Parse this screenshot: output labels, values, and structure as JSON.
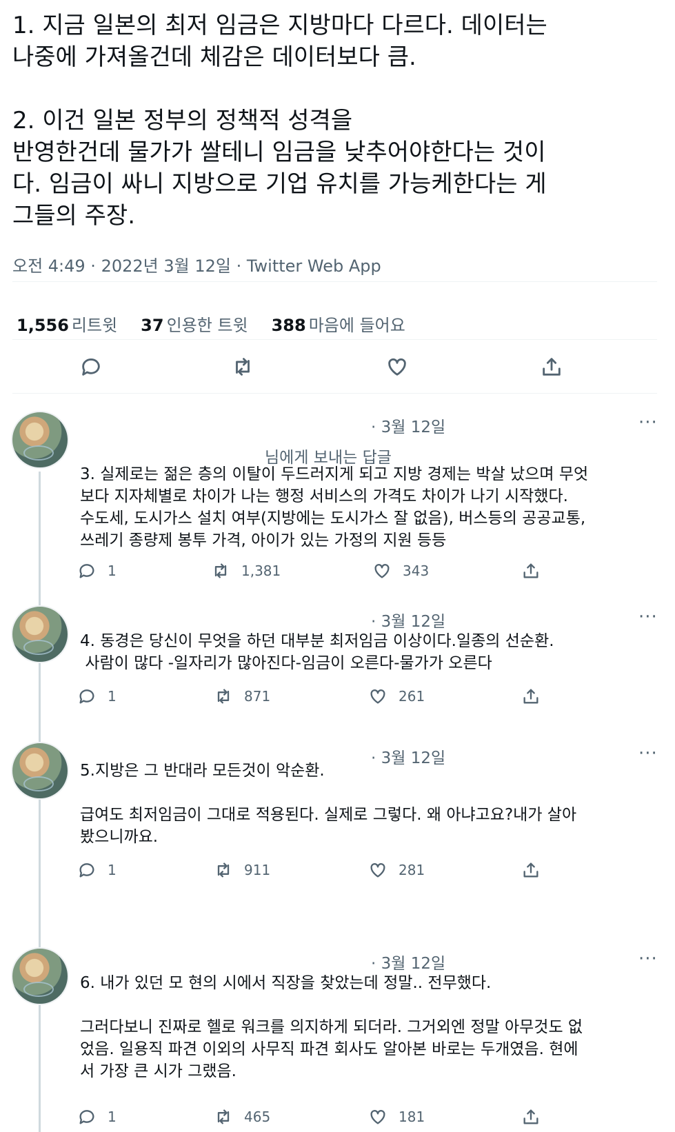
{
  "tweet": {
    "text": "1. 지금 일본의 최저 임금은 지방마다 다르다. 데이터는\n나중에 가져올건데 체감은 데이터보다 큼.\n\n2. 이건 일본 정부의 정책적 성격을\n반영한건데 물가가 쌀테니 임금을 낮추어야한다는 것이\n다. 임금이 싸니 지방으로 기업 유치를 가능케한다는 게\n그들의 주장.",
    "timestamp": "오전 4:49 · 2022년 3월 12일 · Twitter Web App",
    "stats": [
      {
        "count": "1,556",
        "label": "리트윗"
      },
      {
        "count": "37",
        "label": "인용한 트윗"
      },
      {
        "count": "388",
        "label": "마음에 들어요"
      }
    ]
  },
  "replies": [
    {
      "date": "· 3월 12일",
      "replying": "님에게 보내는 답글",
      "text": "3. 실제로는 젊은 층의 이탈이 두드러지게 되고 지방 경제는 박살 났으며 무엇\n보다 지자체별로 차이가 나는 행정 서비스의 가격도 차이가 나기 시작했다.\n수도세, 도시가스 설치 여부(지방에는 도시가스 잘 없음), 버스등의 공공교통,\n쓰레기 종량제 봉투 가격, 아이가 있는 가정의 지원 등등",
      "reply_count": "1",
      "retweet_count": "1,381",
      "like_count": "343"
    },
    {
      "date": "· 3월 12일",
      "text": "4. 동경은 당신이 무엇을 하던 대부분 최저임금 이상이다.일종의 선순환.\n 사람이 많다 -일자리가 많아진다-임금이 오른다-물가가 오른다",
      "reply_count": "1",
      "retweet_count": "871",
      "like_count": "261"
    },
    {
      "date": "· 3월 12일",
      "text": "5.지방은 그 반대라 모든것이 악순환.\n\n급여도 최저임금이 그대로 적용된다. 실제로 그렇다. 왜 아냐고요?내가 살아\n봤으니까요.",
      "reply_count": "1",
      "retweet_count": "911",
      "like_count": "281"
    },
    {
      "date": "· 3월 12일",
      "text": "6. 내가 있던 모 현의 시에서 직장을 찾았는데 정말.. 전무했다.\n\n그러다보니 진짜로 헬로 워크를 의지하게 되더라. 그거외엔 정말 아무것도 없\n었음. 일용직 파견 이외의 사무직 파견 회사도 알아본 바로는 두개였음. 현에\n서 가장 큰 시가 그랬음.",
      "reply_count": "1",
      "retweet_count": "465",
      "like_count": "181"
    }
  ],
  "more_label": "···",
  "icons": {
    "reply": "reply-icon",
    "retweet": "retweet-icon",
    "like": "like-icon",
    "share": "share-icon"
  }
}
